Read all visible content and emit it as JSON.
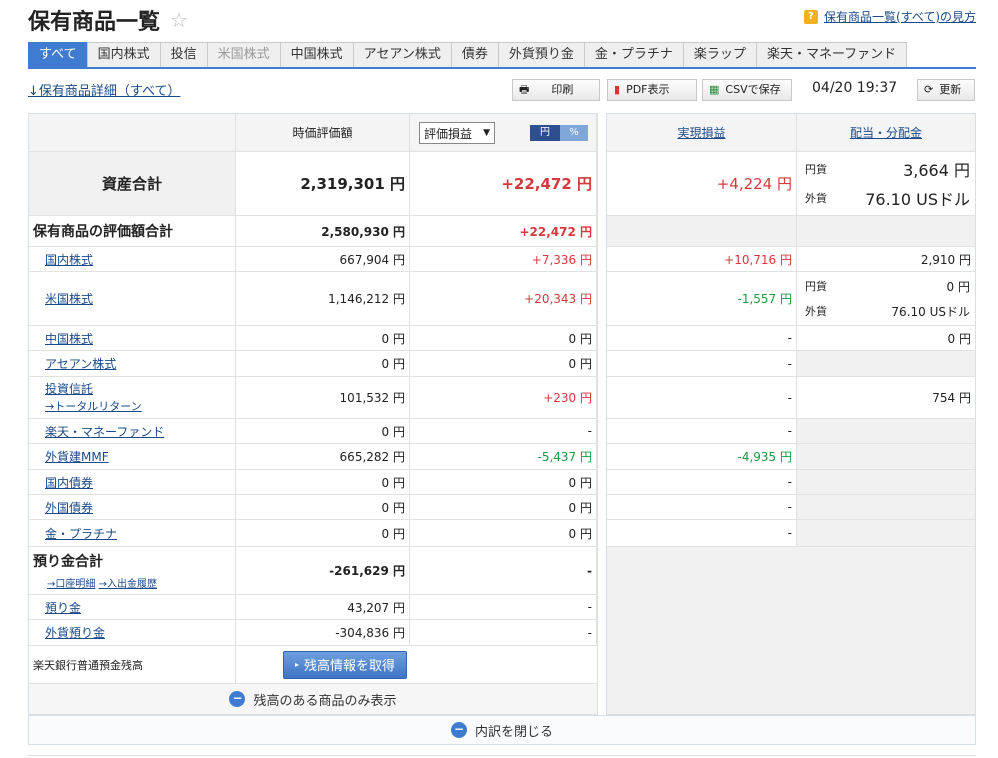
{
  "header": {
    "title": "保有商品一覧",
    "help_link": "保有商品一覧(すべて)の見方"
  },
  "tabs": [
    "すべて",
    "国内株式",
    "投信",
    "米国株式",
    "中国株式",
    "アセアン株式",
    "債券",
    "外貨預り金",
    "金・プラチナ",
    "楽ラップ",
    "楽天・マネーファンド"
  ],
  "toolbar": {
    "detail_link": "↓保有商品詳細（すべて）",
    "print": "印刷",
    "pdf": "PDF表示",
    "csv": "CSVで保存",
    "timestamp": "04/20 19:37",
    "refresh": "更新"
  },
  "columns": {
    "market_value": "時価評価額",
    "gain_select": "評価損益",
    "unit_yen": "円",
    "unit_pct": "%",
    "realized": "実現損益",
    "dividend": "配当・分配金"
  },
  "total": {
    "label": "資産合計",
    "value": "2,319,301 円",
    "gain": "+22,472 円",
    "realized": "+4,224 円",
    "div_yen_label": "円貨",
    "div_yen": "3,664 円",
    "div_fx_label": "外貨",
    "div_fx": "76.10 USドル"
  },
  "holdings_total": {
    "label": "保有商品の評価額合計",
    "value": "2,580,930 円",
    "gain": "+22,472 円"
  },
  "rows": [
    {
      "label": "国内株式",
      "value": "667,904 円",
      "gain": "+7,336 円",
      "realized": "+10,716 円",
      "dividend": "2,910 円"
    },
    {
      "label": "米国株式",
      "value": "1,146,212 円",
      "gain": "+20,343 円",
      "realized": "-1,557 円",
      "div_yen_label": "円貨",
      "div_yen": "0 円",
      "div_fx_label": "外貨",
      "div_fx": "76.10 USドル"
    },
    {
      "label": "中国株式",
      "value": "0 円",
      "gain": "0 円",
      "realized": "-",
      "dividend": "0 円"
    },
    {
      "label": "アセアン株式",
      "value": "0 円",
      "gain": "0 円",
      "realized": "-",
      "dividend": ""
    },
    {
      "label": "投資信託",
      "sublink": "→トータルリターン",
      "value": "101,532 円",
      "gain": "+230 円",
      "realized": "-",
      "dividend": "754 円"
    },
    {
      "label": "楽天・マネーファンド",
      "value": "0 円",
      "gain": "-",
      "realized": "-",
      "dividend": ""
    },
    {
      "label": "外貨建MMF",
      "value": "665,282 円",
      "gain": "-5,437 円",
      "realized": "-4,935 円",
      "dividend": ""
    },
    {
      "label": "国内債券",
      "value": "0 円",
      "gain": "0 円",
      "realized": "-",
      "dividend": ""
    },
    {
      "label": "外国債券",
      "value": "0 円",
      "gain": "0 円",
      "realized": "-",
      "dividend": ""
    },
    {
      "label": "金・プラチナ",
      "value": "0 円",
      "gain": "0 円",
      "realized": "-",
      "dividend": ""
    }
  ],
  "deposit": {
    "label": "預り金合計",
    "link1": "→口座明細",
    "link2": "→入出金履歴",
    "value": "-261,629 円",
    "gain": "-",
    "rows": [
      {
        "label": "預り金",
        "value": "43,207 円",
        "gain": "-"
      },
      {
        "label": "外貨預り金",
        "value": "-304,836 円",
        "gain": "-"
      }
    ]
  },
  "bank": {
    "label": "楽天銀行普通預金残高",
    "button": "残高情報を取得"
  },
  "footer": {
    "show_balance_only": "残高のある商品のみ表示",
    "close_breakdown": "内訳を閉じる"
  },
  "colors": {
    "accent": "#3e7bd1",
    "positive": "#d6393a",
    "negative": "#1d9a3d"
  }
}
